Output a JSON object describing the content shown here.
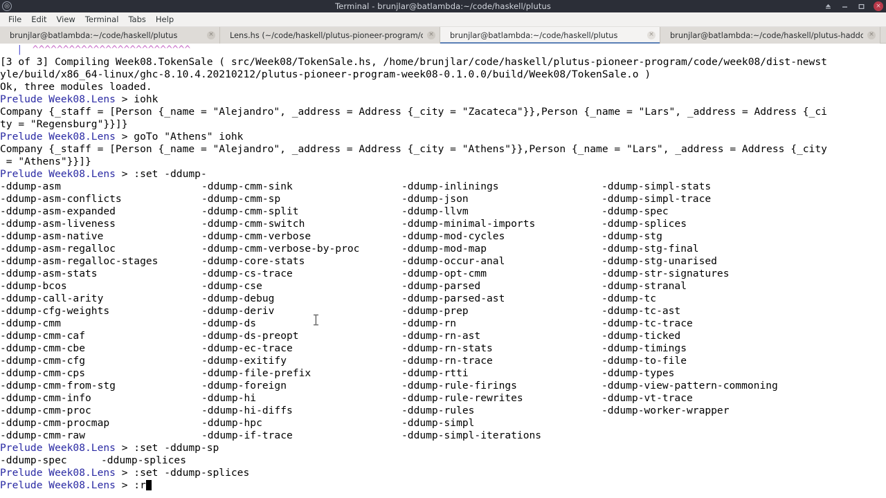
{
  "window": {
    "title": "Terminal - brunjlar@batlambda:~/code/haskell/plutus",
    "app_icon": "terminal-icon",
    "controls": {
      "shade_label": "⌂",
      "minimize_label": "–",
      "maximize_label": "□",
      "close_label": "×"
    }
  },
  "menubar": {
    "items": [
      {
        "label": "File"
      },
      {
        "label": "Edit"
      },
      {
        "label": "View"
      },
      {
        "label": "Terminal"
      },
      {
        "label": "Tabs"
      },
      {
        "label": "Help"
      }
    ]
  },
  "tabs": [
    {
      "label": "brunjlar@batlambda:~/code/haskell/plutus",
      "active": false,
      "close_label": "×"
    },
    {
      "label": "Lens.hs (~/code/haskell/plutus-pioneer-program/code/wee...",
      "active": false,
      "close_label": "×"
    },
    {
      "label": "brunjlar@batlambda:~/code/haskell/plutus",
      "active": true,
      "close_label": "×"
    },
    {
      "label": "brunjlar@batlambda:~/code/haskell/plutus-haddock",
      "active": false,
      "close_label": "×"
    }
  ],
  "colors": {
    "prompt_blue": "#2929a3",
    "caret_pink": "#c96fc9",
    "bar_blue": "#5f5fd7",
    "terminal_bg": "#ffffff",
    "terminal_fg": "#000000",
    "titlebar_bg": "#2b2e37",
    "tab_active_underline": "#5a7fb5",
    "close_button_red": "#b8394a"
  },
  "terminal": {
    "prompt_text": "Prelude Week08.Lens",
    "prompt_suffix": " > ",
    "caret_line": {
      "bar": "|",
      "carets": "^^^^^^^^^^^^^^^^^^^^^^^^^^"
    },
    "lines": [
      {
        "type": "compile",
        "text": "[3 of 3] Compiling Week08.TokenSale ( src/Week08/TokenSale.hs, /home/brunjlar/code/haskell/plutus-pioneer-program/code/week08/dist-newst"
      },
      {
        "type": "compile",
        "text": "yle/build/x86_64-linux/ghc-8.10.4.20210212/plutus-pioneer-program-week08-0.1.0.0/build/Week08/TokenSale.o )"
      },
      {
        "type": "plain",
        "text": "Ok, three modules loaded."
      },
      {
        "type": "prompt",
        "command": "iohk"
      },
      {
        "type": "plain",
        "text": "Company {_staff = [Person {_name = \"Alejandro\", _address = Address {_city = \"Zacateca\"}},Person {_name = \"Lars\", _address = Address {_ci"
      },
      {
        "type": "plain",
        "text": "ty = \"Regensburg\"}}]}"
      },
      {
        "type": "prompt",
        "command": "goTo \"Athens\" iohk"
      },
      {
        "type": "plain",
        "text": "Company {_staff = [Person {_name = \"Alejandro\", _address = Address {_city = \"Athens\"}},Person {_name = \"Lars\", _address = Address {_city"
      },
      {
        "type": "plain",
        "text": " = \"Athens\"}}]}"
      },
      {
        "type": "prompt",
        "command": ":set -ddump-"
      }
    ],
    "flag_table": {
      "rows": [
        [
          "-ddump-asm",
          "-ddump-cmm-sink",
          "-ddump-inlinings",
          "-ddump-simpl-stats"
        ],
        [
          "-ddump-asm-conflicts",
          "-ddump-cmm-sp",
          "-ddump-json",
          "-ddump-simpl-trace"
        ],
        [
          "-ddump-asm-expanded",
          "-ddump-cmm-split",
          "-ddump-llvm",
          "-ddump-spec"
        ],
        [
          "-ddump-asm-liveness",
          "-ddump-cmm-switch",
          "-ddump-minimal-imports",
          "-ddump-splices"
        ],
        [
          "-ddump-asm-native",
          "-ddump-cmm-verbose",
          "-ddump-mod-cycles",
          "-ddump-stg"
        ],
        [
          "-ddump-asm-regalloc",
          "-ddump-cmm-verbose-by-proc",
          "-ddump-mod-map",
          "-ddump-stg-final"
        ],
        [
          "-ddump-asm-regalloc-stages",
          "-ddump-core-stats",
          "-ddump-occur-anal",
          "-ddump-stg-unarised"
        ],
        [
          "-ddump-asm-stats",
          "-ddump-cs-trace",
          "-ddump-opt-cmm",
          "-ddump-str-signatures"
        ],
        [
          "-ddump-bcos",
          "-ddump-cse",
          "-ddump-parsed",
          "-ddump-stranal"
        ],
        [
          "-ddump-call-arity",
          "-ddump-debug",
          "-ddump-parsed-ast",
          "-ddump-tc"
        ],
        [
          "-ddump-cfg-weights",
          "-ddump-deriv",
          "-ddump-prep",
          "-ddump-tc-ast"
        ],
        [
          "-ddump-cmm",
          "-ddump-ds",
          "-ddump-rn",
          "-ddump-tc-trace"
        ],
        [
          "-ddump-cmm-caf",
          "-ddump-ds-preopt",
          "-ddump-rn-ast",
          "-ddump-ticked"
        ],
        [
          "-ddump-cmm-cbe",
          "-ddump-ec-trace",
          "-ddump-rn-stats",
          "-ddump-timings"
        ],
        [
          "-ddump-cmm-cfg",
          "-ddump-exitify",
          "-ddump-rn-trace",
          "-ddump-to-file"
        ],
        [
          "-ddump-cmm-cps",
          "-ddump-file-prefix",
          "-ddump-rtti",
          "-ddump-types"
        ],
        [
          "-ddump-cmm-from-stg",
          "-ddump-foreign",
          "-ddump-rule-firings",
          "-ddump-view-pattern-commoning"
        ],
        [
          "-ddump-cmm-info",
          "-ddump-hi",
          "-ddump-rule-rewrites",
          "-ddump-vt-trace"
        ],
        [
          "-ddump-cmm-proc",
          "-ddump-hi-diffs",
          "-ddump-rules",
          "-ddump-worker-wrapper"
        ],
        [
          "-ddump-cmm-procmap",
          "-ddump-hpc",
          "-ddump-simpl",
          ""
        ],
        [
          "-ddump-cmm-raw",
          "-ddump-if-trace",
          "-ddump-simpl-iterations",
          ""
        ]
      ]
    },
    "tail_lines": [
      {
        "type": "prompt",
        "command": ":set -ddump-sp"
      },
      {
        "type": "completion",
        "cols": [
          "-ddump-spec",
          "-ddump-splices"
        ]
      },
      {
        "type": "prompt",
        "command": ":set -ddump-splices"
      },
      {
        "type": "prompt_cursor",
        "command": ":r"
      }
    ]
  }
}
